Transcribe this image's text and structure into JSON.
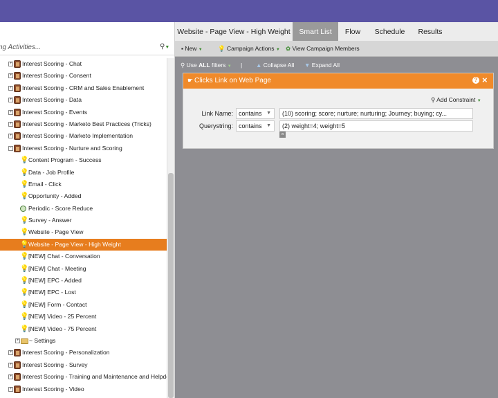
{
  "left_panel": {
    "search_placeholder": "ng Activities...",
    "tree": [
      {
        "label": "Interest Scoring - Chat",
        "type": "program",
        "toggle": "+",
        "level": 0
      },
      {
        "label": "Interest Scoring - Consent",
        "type": "program",
        "toggle": "+",
        "level": 0
      },
      {
        "label": "Interest Scoring - CRM and Sales Enablement",
        "type": "program",
        "toggle": "+",
        "level": 0
      },
      {
        "label": "Interest Scoring - Data",
        "type": "program",
        "toggle": "+",
        "level": 0
      },
      {
        "label": "Interest Scoring - Events",
        "type": "program",
        "toggle": "+",
        "level": 0
      },
      {
        "label": "Interest Scoring - Marketo Best Practices (Tricks)",
        "type": "program",
        "toggle": "+",
        "level": 0
      },
      {
        "label": "Interest Scoring - Marketo Implementation",
        "type": "program",
        "toggle": "+",
        "level": 0
      },
      {
        "label": "Interest Scoring - Nurture and Scoring",
        "type": "program",
        "toggle": "-",
        "level": 0
      },
      {
        "label": "Content Program - Success",
        "type": "bulb",
        "level": 1
      },
      {
        "label": "Data - Job Profile",
        "type": "bulb",
        "level": 1
      },
      {
        "label": "Email - Click",
        "type": "bulb",
        "level": 1
      },
      {
        "label": "Opportunity - Added",
        "type": "bulb",
        "level": 1
      },
      {
        "label": "Periodic - Score Reduce",
        "type": "clock",
        "level": 1
      },
      {
        "label": "Survey - Answer",
        "type": "bulb",
        "level": 1
      },
      {
        "label": "Website - Page View",
        "type": "bulb",
        "level": 1
      },
      {
        "label": "Website - Page View - High Weight",
        "type": "bulb",
        "level": 1,
        "selected": true
      },
      {
        "label": "[NEW] Chat - Conversation",
        "type": "bulb",
        "level": 1
      },
      {
        "label": "[NEW] Chat - Meeting",
        "type": "bulb",
        "level": 1
      },
      {
        "label": "[NEW] EPC - Added",
        "type": "bulb",
        "level": 1
      },
      {
        "label": "[NEW] EPC - Lost",
        "type": "bulb",
        "level": 1
      },
      {
        "label": "[NEW] Form - Contact",
        "type": "bulb",
        "level": 1
      },
      {
        "label": "[NEW] Video - 25 Percent",
        "type": "bulb",
        "level": 1
      },
      {
        "label": "[NEW] Video - 75 Percent",
        "type": "bulb",
        "level": 1
      },
      {
        "label": "~ Settings",
        "type": "folder",
        "toggle": "+",
        "level": 1
      },
      {
        "label": "Interest Scoring - Personalization",
        "type": "program",
        "toggle": "+",
        "level": 0
      },
      {
        "label": "Interest Scoring - Survey",
        "type": "program",
        "toggle": "+",
        "level": 0
      },
      {
        "label": "Interest Scoring - Training and Maintenance and Helpde",
        "type": "program",
        "toggle": "+",
        "level": 0
      },
      {
        "label": "Interest Scoring - Video",
        "type": "program",
        "toggle": "+",
        "level": 0
      }
    ]
  },
  "tabs": [
    {
      "label": "Website - Page View - High Weight",
      "active": false
    },
    {
      "label": "Smart List",
      "active": true
    },
    {
      "label": "Flow",
      "active": false
    },
    {
      "label": "Schedule",
      "active": false
    },
    {
      "label": "Results",
      "active": false
    }
  ],
  "toolbar": {
    "new_label": "New",
    "campaign_actions_label": "Campaign Actions",
    "view_members_label": "View Campaign Members"
  },
  "subbar": {
    "use_label": "Use",
    "all_label": "ALL",
    "filters_label": "filters",
    "separator": "|",
    "collapse_label": "Collapse All",
    "expand_label": "Expand All"
  },
  "filter_panel": {
    "title": "Clicks Link on Web Page",
    "add_constraint_label": "Add Constraint",
    "rows": [
      {
        "label": "Link Name:",
        "operator": "contains",
        "value": "(10) scoring; score; nurture; nurturing; Journey; buying; cy..."
      },
      {
        "label": "Querystring:",
        "operator": "contains",
        "value": "(2) weight=4; weight=5"
      }
    ]
  },
  "colors": {
    "header": "#5a54a4",
    "accent_orange": "#e77d1e",
    "canvas_gray": "#8e8e93"
  }
}
